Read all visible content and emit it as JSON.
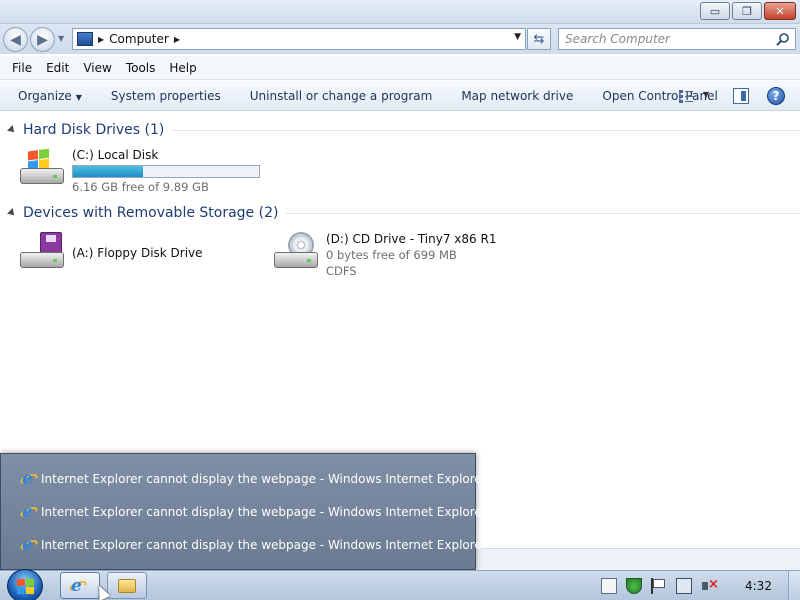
{
  "window": {
    "minimize_glyph": "▭",
    "maximize_glyph": "❐",
    "close_glyph": "✕"
  },
  "address": {
    "location": "Computer",
    "search_placeholder": "Search Computer"
  },
  "menu": {
    "items": [
      "File",
      "Edit",
      "View",
      "Tools",
      "Help"
    ]
  },
  "commands": {
    "organize": "Organize",
    "system_properties": "System properties",
    "uninstall": "Uninstall or change a program",
    "map_drive": "Map network drive",
    "control_panel": "Open Control Panel",
    "help_glyph": "?"
  },
  "groups": {
    "hard_disk": {
      "title": "Hard Disk Drives (1)",
      "drives": [
        {
          "name": "(C:) Local Disk",
          "free_text": "6.16 GB free of 9.89 GB",
          "used_fraction": 0.377
        }
      ]
    },
    "removable": {
      "title": "Devices with Removable Storage (2)",
      "drives": [
        {
          "name": "(A:) Floppy Disk Drive"
        },
        {
          "name": "(D:) CD Drive - Tiny7 x86 R1",
          "free_text": "0 bytes free of 699 MB",
          "filesystem": "CDFS"
        }
      ]
    }
  },
  "popup": {
    "items": [
      "Internet Explorer cannot display the webpage - Windows Internet Explorer",
      "Internet Explorer cannot display the webpage - Windows Internet Explorer",
      "Internet Explorer cannot display the webpage - Windows Internet Explorer"
    ]
  },
  "taskbar": {
    "clock": "4:32"
  },
  "colors": {
    "accent": "#1e3d75",
    "usage_fill": "#1f8ec5",
    "popup_bg": "#6a7b92"
  }
}
